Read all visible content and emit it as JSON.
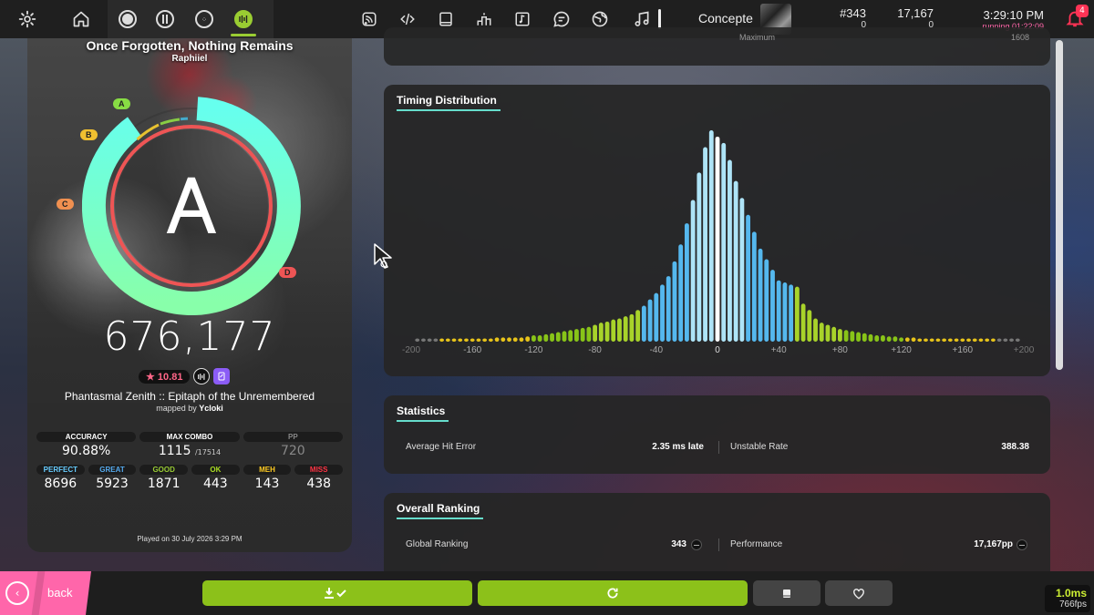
{
  "topbar": {
    "icons": [
      "gear-icon",
      "home-icon",
      "osu-ruleset-icon",
      "taiko-ruleset-icon",
      "catch-ruleset-icon",
      "mania-ruleset-icon",
      "rss-icon",
      "code-icon",
      "book-icon",
      "podium-icon",
      "music-file-icon",
      "chat-icon",
      "globe-icon",
      "music-note-icon"
    ],
    "user_name": "Concepte",
    "global_rank": "#343",
    "global_rank_change": "0",
    "pp": "17,167",
    "pp_change": "0",
    "time": "3:29:10 PM",
    "running": "running 01:22:09",
    "notifications": "4"
  },
  "left": {
    "song_title": "Once Forgotten, Nothing Remains",
    "artist": "Raphiiel",
    "rank": "A",
    "rank_labels": [
      "A",
      "B",
      "C",
      "D"
    ],
    "accuracy_fraction": 0.9088,
    "score": "676,177",
    "star_rating": "★ 10.81",
    "beatmap": "Phantasmal Zenith :: Epitaph of the Unremembered",
    "mapped_by_prefix": "mapped by",
    "mapper": "Ycloki",
    "stats_top": [
      {
        "label": "ACCURACY",
        "value": "90.88%",
        "color": "#ffffff"
      },
      {
        "label": "MAX COMBO",
        "value": "1115",
        "sub": "/17514",
        "color": "#ffffff"
      },
      {
        "label": "PP",
        "value": "720",
        "color": "#888888"
      }
    ],
    "stats_bottom": [
      {
        "label": "PERFECT",
        "value": "8696",
        "color": "#66ccff"
      },
      {
        "label": "GREAT",
        "value": "5923",
        "color": "#55aaee"
      },
      {
        "label": "GOOD",
        "value": "1871",
        "color": "#99cc33"
      },
      {
        "label": "OK",
        "value": "443",
        "color": "#aadd22"
      },
      {
        "label": "MEH",
        "value": "143",
        "color": "#ffcc22"
      },
      {
        "label": "MISS",
        "value": "438",
        "color": "#ff3344"
      }
    ],
    "played_on": "Played on 30 July 2026 3:29 PM"
  },
  "top_panel": {
    "label": "Maximum",
    "value": "1608"
  },
  "timing": {
    "title": "Timing Distribution"
  },
  "chart_data": {
    "type": "bar",
    "title": "Timing Distribution",
    "xlabel": "",
    "ylabel": "",
    "x_ticks": [
      "-200",
      "-160",
      "-120",
      "-80",
      "-40",
      "0",
      "+40",
      "+80",
      "+120",
      "+160",
      "+200"
    ],
    "xlim": [
      -200,
      200
    ],
    "ylim": [
      0,
      100
    ],
    "bin_width_ms": 4,
    "bins": [
      {
        "x": -196,
        "v": 1.5
      },
      {
        "x": -192,
        "v": 1.5
      },
      {
        "x": -188,
        "v": 1.5
      },
      {
        "x": -184,
        "v": 1.5
      },
      {
        "x": -180,
        "v": 1.5
      },
      {
        "x": -176,
        "v": 1.5
      },
      {
        "x": -172,
        "v": 1.5
      },
      {
        "x": -168,
        "v": 1.5
      },
      {
        "x": -164,
        "v": 1.5
      },
      {
        "x": -160,
        "v": 1.5
      },
      {
        "x": -156,
        "v": 1.5
      },
      {
        "x": -152,
        "v": 1.5
      },
      {
        "x": -148,
        "v": 1.5
      },
      {
        "x": -144,
        "v": 2
      },
      {
        "x": -140,
        "v": 2
      },
      {
        "x": -136,
        "v": 2
      },
      {
        "x": -132,
        "v": 2
      },
      {
        "x": -128,
        "v": 2
      },
      {
        "x": -124,
        "v": 2.5
      },
      {
        "x": -120,
        "v": 3
      },
      {
        "x": -116,
        "v": 3
      },
      {
        "x": -112,
        "v": 3.5
      },
      {
        "x": -108,
        "v": 4
      },
      {
        "x": -104,
        "v": 4.5
      },
      {
        "x": -100,
        "v": 5
      },
      {
        "x": -96,
        "v": 5.5
      },
      {
        "x": -92,
        "v": 6
      },
      {
        "x": -88,
        "v": 6.5
      },
      {
        "x": -84,
        "v": 7
      },
      {
        "x": -80,
        "v": 8
      },
      {
        "x": -76,
        "v": 9
      },
      {
        "x": -72,
        "v": 9.5
      },
      {
        "x": -68,
        "v": 10.5
      },
      {
        "x": -64,
        "v": 11
      },
      {
        "x": -60,
        "v": 12
      },
      {
        "x": -56,
        "v": 13
      },
      {
        "x": -52,
        "v": 15
      },
      {
        "x": -48,
        "v": 17
      },
      {
        "x": -44,
        "v": 20
      },
      {
        "x": -40,
        "v": 23
      },
      {
        "x": -36,
        "v": 27
      },
      {
        "x": -32,
        "v": 31
      },
      {
        "x": -28,
        "v": 38
      },
      {
        "x": -24,
        "v": 46
      },
      {
        "x": -20,
        "v": 56
      },
      {
        "x": -16,
        "v": 67
      },
      {
        "x": -12,
        "v": 80
      },
      {
        "x": -8,
        "v": 92
      },
      {
        "x": -4,
        "v": 100
      },
      {
        "x": 0,
        "v": 97
      },
      {
        "x": 4,
        "v": 94
      },
      {
        "x": 8,
        "v": 86
      },
      {
        "x": 12,
        "v": 76
      },
      {
        "x": 16,
        "v": 68
      },
      {
        "x": 20,
        "v": 60
      },
      {
        "x": 24,
        "v": 52
      },
      {
        "x": 28,
        "v": 44
      },
      {
        "x": 32,
        "v": 39
      },
      {
        "x": 36,
        "v": 34
      },
      {
        "x": 40,
        "v": 29
      },
      {
        "x": 44,
        "v": 28
      },
      {
        "x": 48,
        "v": 27
      },
      {
        "x": 52,
        "v": 26
      },
      {
        "x": 56,
        "v": 18
      },
      {
        "x": 60,
        "v": 15
      },
      {
        "x": 64,
        "v": 11
      },
      {
        "x": 68,
        "v": 9
      },
      {
        "x": 72,
        "v": 8
      },
      {
        "x": 76,
        "v": 7
      },
      {
        "x": 80,
        "v": 6
      },
      {
        "x": 84,
        "v": 5.5
      },
      {
        "x": 88,
        "v": 5
      },
      {
        "x": 92,
        "v": 4.5
      },
      {
        "x": 96,
        "v": 4
      },
      {
        "x": 100,
        "v": 3.5
      },
      {
        "x": 104,
        "v": 3
      },
      {
        "x": 108,
        "v": 3
      },
      {
        "x": 112,
        "v": 2.5
      },
      {
        "x": 116,
        "v": 2.5
      },
      {
        "x": 120,
        "v": 2
      },
      {
        "x": 124,
        "v": 2
      },
      {
        "x": 128,
        "v": 2
      },
      {
        "x": 132,
        "v": 1.5
      },
      {
        "x": 136,
        "v": 1.5
      },
      {
        "x": 140,
        "v": 1.5
      },
      {
        "x": 144,
        "v": 1.5
      },
      {
        "x": 148,
        "v": 1.5
      },
      {
        "x": 152,
        "v": 1.5
      },
      {
        "x": 156,
        "v": 1.5
      },
      {
        "x": 160,
        "v": 1.5
      },
      {
        "x": 164,
        "v": 1.5
      },
      {
        "x": 168,
        "v": 1.5
      },
      {
        "x": 172,
        "v": 1.5
      },
      {
        "x": 176,
        "v": 1.5
      },
      {
        "x": 180,
        "v": 1.5
      },
      {
        "x": 184,
        "v": 1.5
      },
      {
        "x": 188,
        "v": 1.5
      },
      {
        "x": 192,
        "v": 1.5
      },
      {
        "x": 196,
        "v": 1.5
      }
    ],
    "judgement_colors": {
      "perfect": "#aee4f7",
      "great": "#55b8ee",
      "good": "#a8d32a",
      "ok": "#88c418",
      "meh": "#e8c41a",
      "miss": "#777777"
    },
    "windows_ms": {
      "perfect": 16,
      "great": 50,
      "good": 80,
      "ok": 120,
      "meh": 180
    }
  },
  "statistics": {
    "title": "Statistics",
    "avg_hit_error_label": "Average Hit Error",
    "avg_hit_error": "2.35 ms late",
    "ur_label": "Unstable Rate",
    "ur": "388.38"
  },
  "ranking": {
    "title": "Overall Ranking",
    "global_label": "Global Ranking",
    "global": "343",
    "perf_label": "Performance",
    "perf": "17,167pp"
  },
  "bottom": {
    "back": "back",
    "fps_ms": "1.0ms",
    "fps": "766fps"
  }
}
